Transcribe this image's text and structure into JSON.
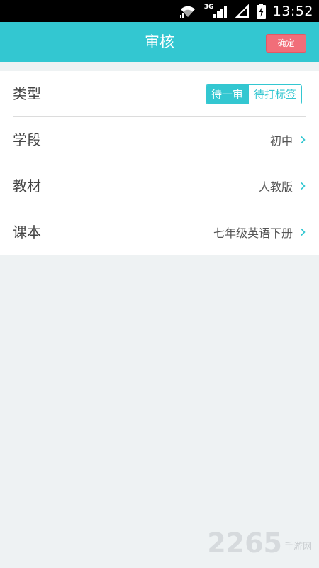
{
  "status_bar": {
    "network": "3G",
    "time": "13:52",
    "icons": [
      "wifi-icon",
      "signal-icon",
      "sim-icon",
      "battery-charging-icon"
    ]
  },
  "header": {
    "title": "审核",
    "confirm_label": "确定"
  },
  "form": {
    "type_row": {
      "label": "类型",
      "options": [
        "待一审",
        "待打标签"
      ],
      "selected": "待一审"
    },
    "stage_row": {
      "label": "学段",
      "value": "初中"
    },
    "textbook_row": {
      "label": "教材",
      "value": "人教版"
    },
    "book_row": {
      "label": "课本",
      "value": "七年级英语下册"
    }
  },
  "watermark": {
    "number": "2265",
    "text": "手游网"
  },
  "colors": {
    "accent": "#33c7d1",
    "confirm": "#f16e79",
    "background": "#eef2f3"
  }
}
